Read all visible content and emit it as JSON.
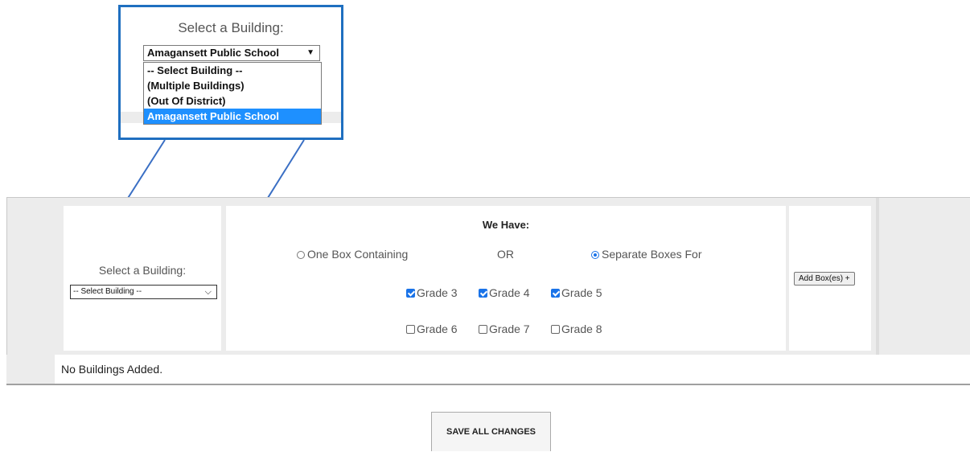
{
  "callout": {
    "title": "Select a Building:",
    "selected": "Amagansett Public School",
    "arrow": "▼",
    "options": [
      "-- Select Building --",
      "(Multiple Buildings)",
      "(Out Of District)",
      "Amagansett Public School"
    ]
  },
  "form": {
    "building_label": "Select a Building:",
    "building_select_value": "-- Select Building --",
    "we_have": "We Have:",
    "radio_one": "One Box Containing",
    "or_text": "OR",
    "radio_separate": "Separate Boxes For",
    "grades": [
      {
        "label": "Grade 3",
        "checked": true
      },
      {
        "label": "Grade 4",
        "checked": true
      },
      {
        "label": "Grade 5",
        "checked": true
      },
      {
        "label": "Grade 6",
        "checked": false
      },
      {
        "label": "Grade 7",
        "checked": false
      },
      {
        "label": "Grade 8",
        "checked": false
      }
    ],
    "add_button": "Add Box(es) +"
  },
  "status": "No Buildings Added.",
  "save_button": "SAVE ALL CHANGES",
  "colors": {
    "callout_border": "#1f6fc0",
    "accent": "#1a73e8",
    "highlight": "#1e90ff"
  }
}
